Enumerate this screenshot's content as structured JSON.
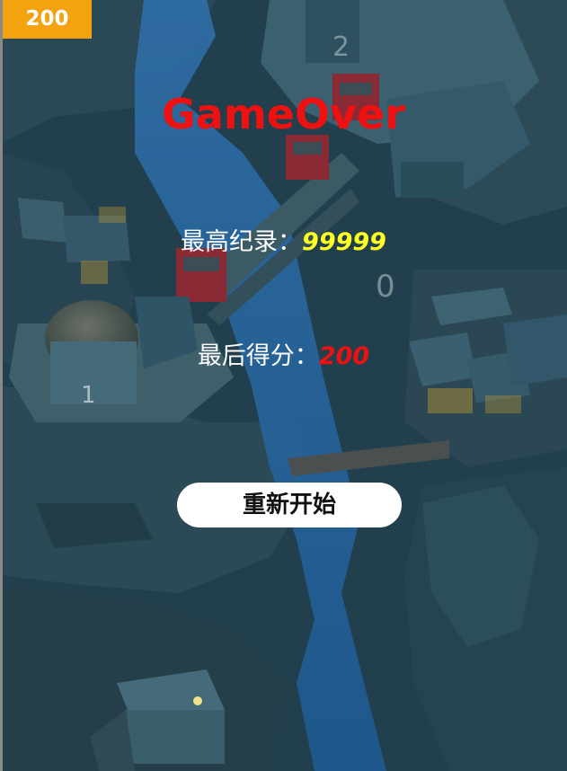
{
  "score_badge": "200",
  "title": "GameOver",
  "best_record": {
    "label": "最高纪录：",
    "value": "99999"
  },
  "last_score": {
    "label": "最后得分：",
    "value": "200"
  },
  "restart_button": "重新开始",
  "colors": {
    "badge": "#f4a20f",
    "title": "#ee1111",
    "best_value": "#ffff22",
    "last_value": "#ee1111",
    "background": "#1d3a48"
  }
}
